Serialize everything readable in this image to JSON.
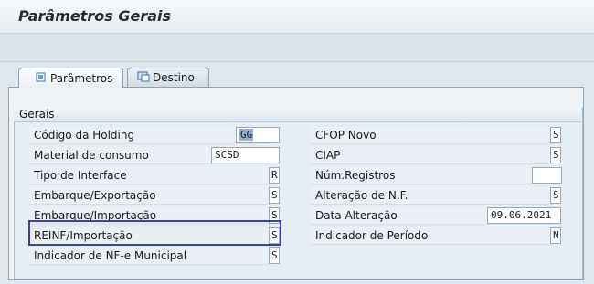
{
  "window": {
    "title": "Parâmetros Gerais"
  },
  "tabs": [
    {
      "label": "Parâmetros",
      "icon": "document-tab-icon",
      "active": true
    },
    {
      "label": "Destino",
      "icon": "screen-tab-icon",
      "active": false
    }
  ],
  "group": {
    "title": "Gerais"
  },
  "left_fields": [
    {
      "label": "Código da Holding",
      "value": "GG"
    },
    {
      "label": "Material de consumo",
      "value": "SCSD"
    },
    {
      "label": "Tipo de Interface",
      "value": "R"
    },
    {
      "label": "Embarque/Exportação",
      "value": "S"
    },
    {
      "label": "Embarque/Importação",
      "value": "S"
    },
    {
      "label": "REINF/Importação",
      "value": "S"
    },
    {
      "label": "Indicador de NF-e Municipal",
      "value": "S"
    }
  ],
  "right_fields": [
    {
      "label": "CFOP Novo",
      "value": "S"
    },
    {
      "label": "CIAP",
      "value": "S"
    },
    {
      "label": "Núm.Registros",
      "value": ""
    },
    {
      "label": "Alteração de N.F.",
      "value": "S"
    },
    {
      "label": "Data Alteração",
      "value": "09.06.2021"
    },
    {
      "label": "Indicador de Período",
      "value": "N"
    }
  ],
  "colors": {
    "highlight_border": "#3b3fb2",
    "selection": "#8fb1d8"
  }
}
